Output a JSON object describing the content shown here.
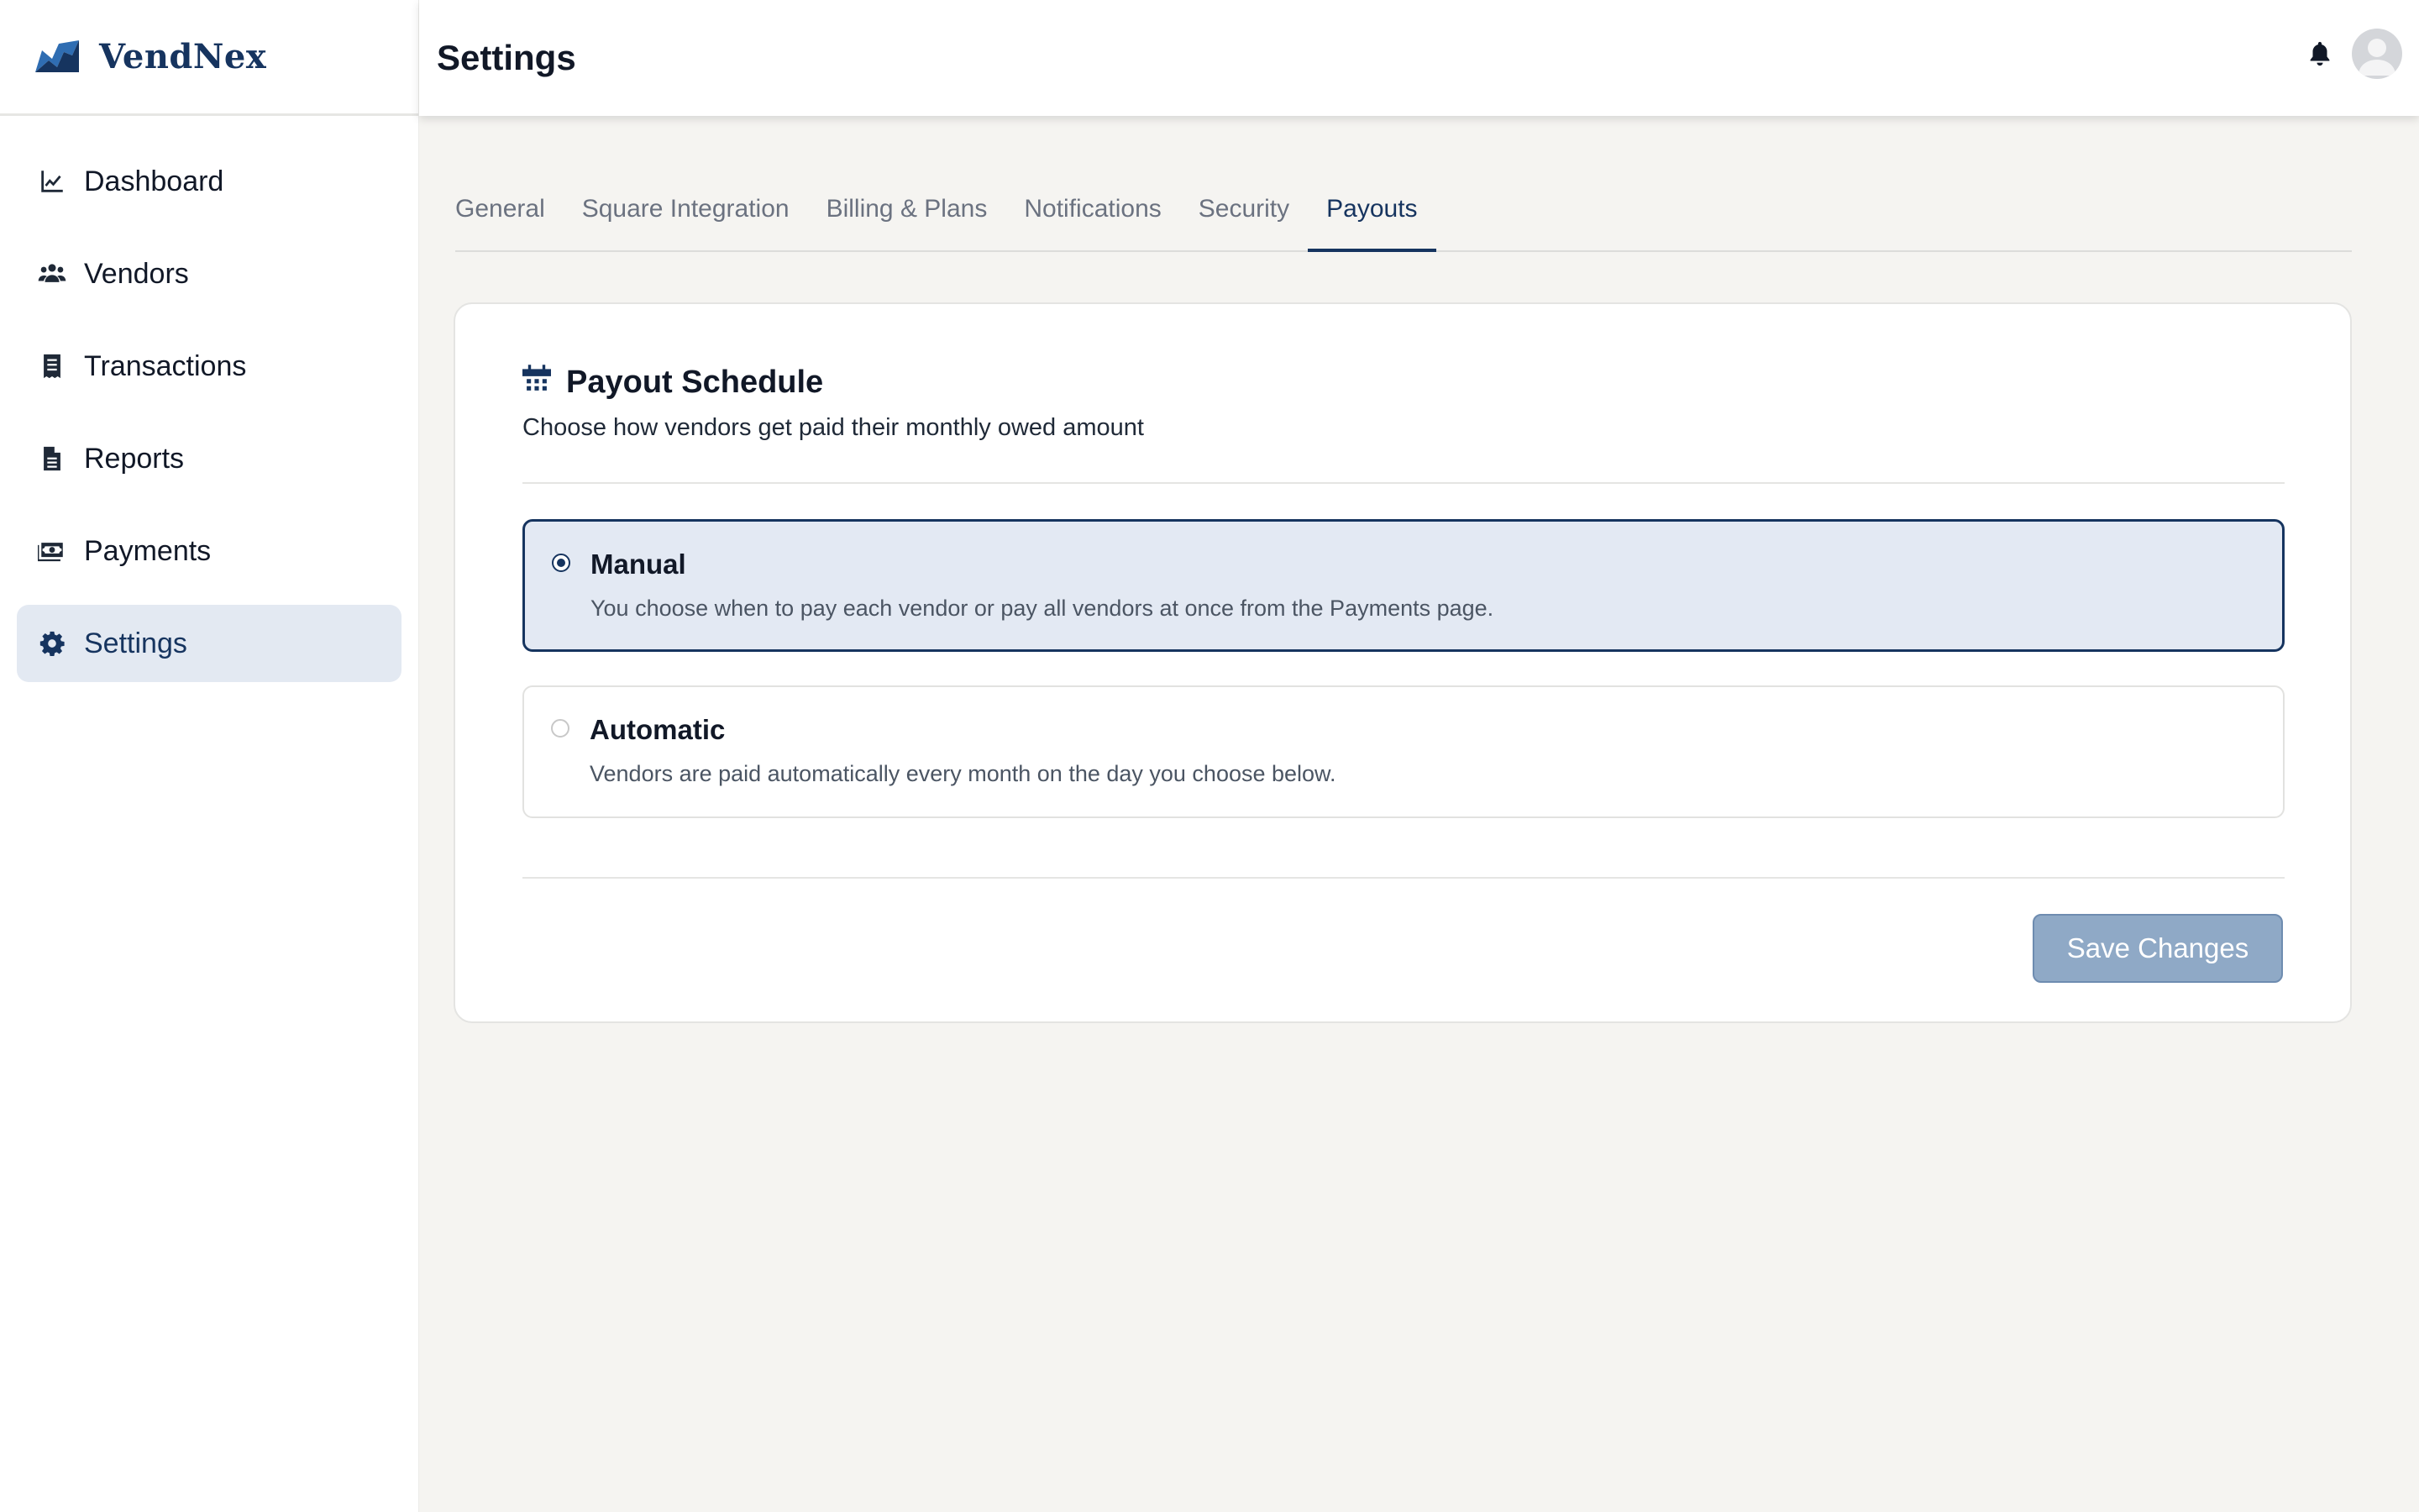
{
  "brand": {
    "name": "VendNex"
  },
  "sidebar": {
    "items": [
      {
        "label": "Dashboard",
        "icon": "chart-line-icon"
      },
      {
        "label": "Vendors",
        "icon": "users-icon"
      },
      {
        "label": "Transactions",
        "icon": "receipt-icon"
      },
      {
        "label": "Reports",
        "icon": "file-icon"
      },
      {
        "label": "Payments",
        "icon": "money-icon"
      },
      {
        "label": "Settings",
        "icon": "gear-icon",
        "active": true
      }
    ]
  },
  "header": {
    "title": "Settings"
  },
  "tabs": [
    {
      "label": "General"
    },
    {
      "label": "Square Integration"
    },
    {
      "label": "Billing & Plans"
    },
    {
      "label": "Notifications"
    },
    {
      "label": "Security"
    },
    {
      "label": "Payouts",
      "active": true
    }
  ],
  "payout": {
    "title": "Payout Schedule",
    "subtitle": "Choose how vendors get paid their monthly owed amount",
    "options": [
      {
        "title": "Manual",
        "description": "You choose when to pay each vendor or pay all vendors at once from the Payments page.",
        "selected": true
      },
      {
        "title": "Automatic",
        "description": "Vendors are paid automatically every month on the day you choose below.",
        "selected": false
      }
    ],
    "save_label": "Save Changes"
  },
  "colors": {
    "accent": "#16345f",
    "active_bg": "#e3e9f2",
    "page_bg": "#f5f4f1",
    "save_button": "#8fa9c6"
  }
}
